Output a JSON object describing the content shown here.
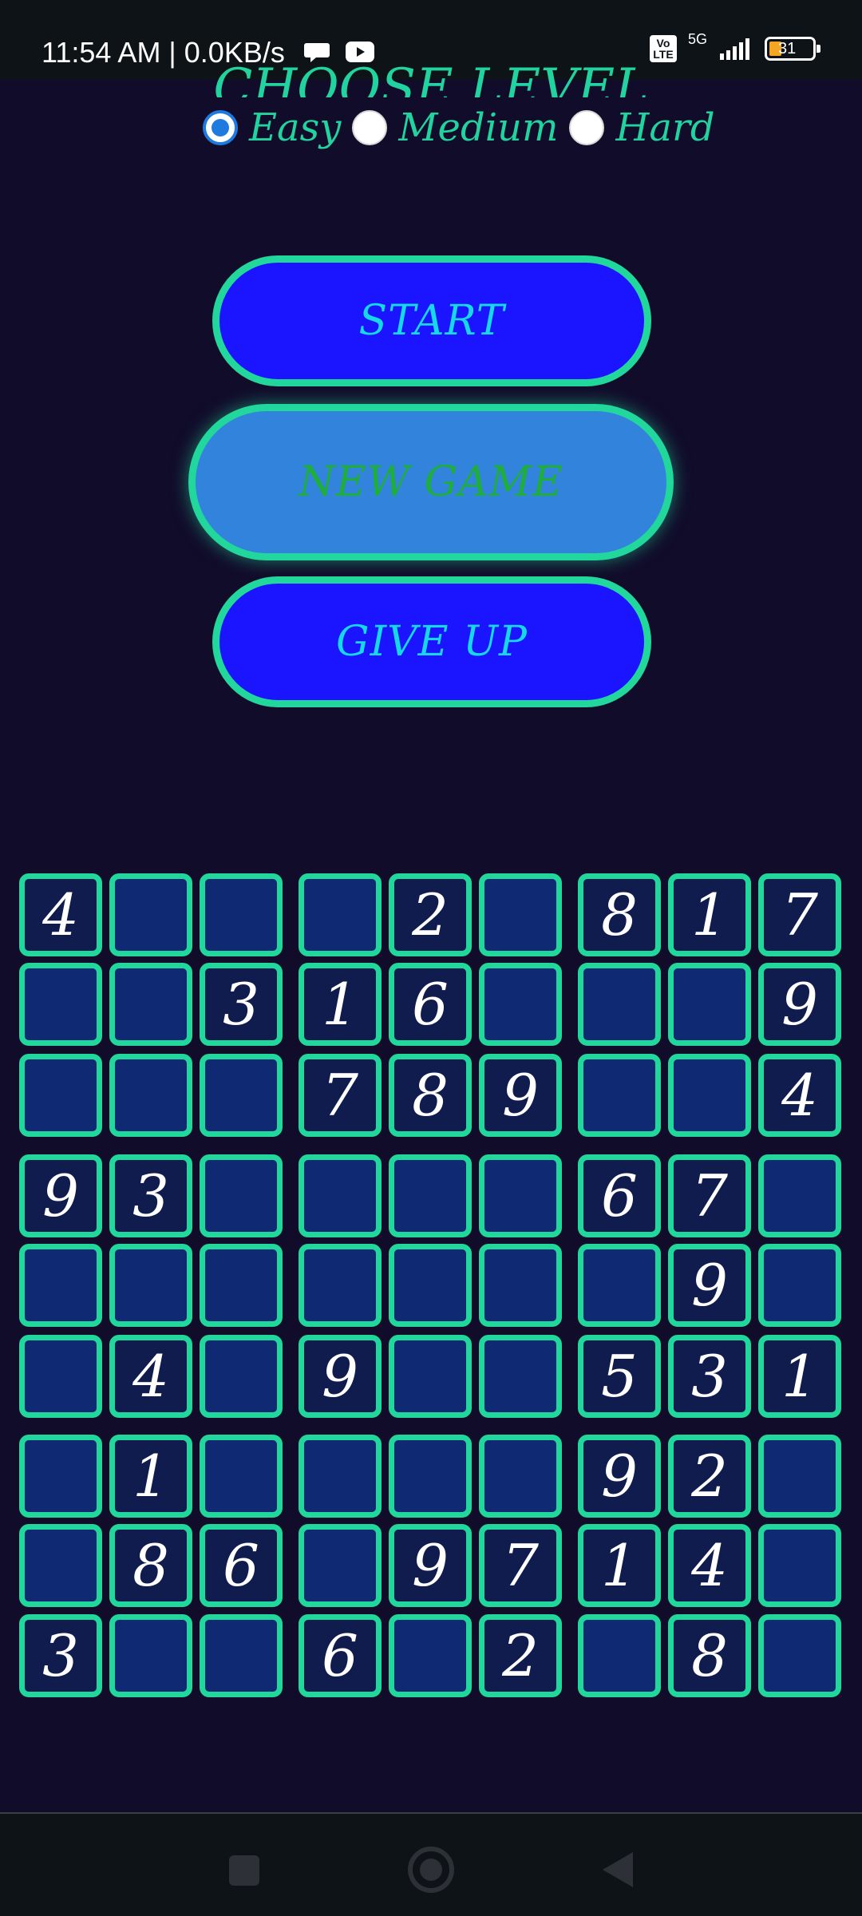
{
  "status_bar": {
    "time_text": "11:54 AM | 0.0KB/s",
    "volte": "Vo\nLTE",
    "network": "5G",
    "battery": "31"
  },
  "level": {
    "title": "CHOOSE LEVEL",
    "options": [
      "Easy",
      "Medium",
      "Hard"
    ],
    "selected": "Easy"
  },
  "buttons": {
    "start": "START",
    "new_game": "NEW GAME",
    "give_up": "GIVE UP"
  },
  "board": {
    "grid": [
      [
        "4",
        "",
        "",
        "",
        "2",
        "",
        "8",
        "1",
        "7"
      ],
      [
        "",
        "",
        "3",
        "1",
        "6",
        "",
        "",
        "",
        "9"
      ],
      [
        "",
        "",
        "",
        "7",
        "8",
        "9",
        "",
        "",
        "4"
      ],
      [
        "9",
        "3",
        "",
        "",
        "",
        "",
        "6",
        "7",
        ""
      ],
      [
        "",
        "",
        "",
        "",
        "",
        "",
        "",
        "9",
        ""
      ],
      [
        "",
        "4",
        "",
        "9",
        "",
        "",
        "5",
        "3",
        "1"
      ],
      [
        "",
        "1",
        "",
        "",
        "",
        "",
        "9",
        "2",
        ""
      ],
      [
        "",
        "8",
        "6",
        "",
        "9",
        "7",
        "1",
        "4",
        ""
      ],
      [
        "3",
        "",
        "",
        "6",
        "",
        "2",
        "",
        "8",
        ""
      ]
    ]
  },
  "colors": {
    "background": "#110c2a",
    "accent": "#22d79b",
    "button_fill": "#1a14ff",
    "new_game_fill": "#3183dc",
    "cell_empty": "#0f2a72",
    "cell_given": "#101c4e"
  },
  "icons": {
    "status_left": [
      "chat-bubble-icon",
      "youtube-icon"
    ],
    "nav": [
      "recents-square-icon",
      "home-circle-icon",
      "back-triangle-icon"
    ]
  }
}
